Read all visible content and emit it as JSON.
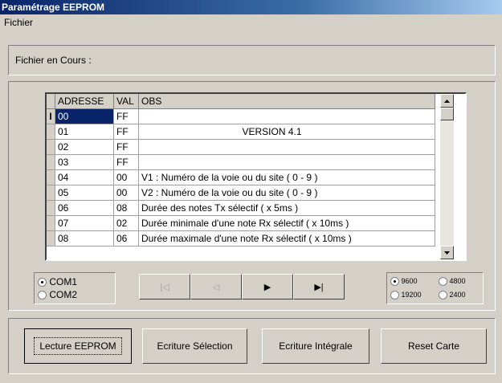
{
  "window": {
    "title": "Paramétrage EEPROM"
  },
  "menu": {
    "items": [
      "Fichier"
    ]
  },
  "file": {
    "label": "Fichier en Cours :"
  },
  "grid": {
    "columns": [
      "ADRESSE",
      "VAL",
      "OBS"
    ],
    "rows": [
      {
        "adresse": "00",
        "val": "FF",
        "obs": ""
      },
      {
        "adresse": "01",
        "val": "FF",
        "obs": "VERSION  4.1"
      },
      {
        "adresse": "02",
        "val": "FF",
        "obs": ""
      },
      {
        "adresse": "03",
        "val": "FF",
        "obs": ""
      },
      {
        "adresse": "04",
        "val": "00",
        "obs": "V1 : Numéro de la voie ou du site ( 0 - 9 )"
      },
      {
        "adresse": "05",
        "val": "00",
        "obs": "V2 : Numéro de la voie ou du site ( 0 - 9 )"
      },
      {
        "adresse": "06",
        "val": "08",
        "obs": "Durée des notes Tx sélectif ( x  5ms )"
      },
      {
        "adresse": "07",
        "val": "02",
        "obs": "Durée minimale d'une note Rx sélectif ( x  10ms )"
      },
      {
        "adresse": "08",
        "val": "06",
        "obs": "Durée maximale d'une note Rx sélectif ( x  10ms )"
      }
    ],
    "selected_row_indicator": "I"
  },
  "com_ports": {
    "options": [
      "COM1",
      "COM2"
    ],
    "selected": "COM1"
  },
  "nav": {
    "first": "|◁",
    "prev": "◁",
    "next": "▶",
    "last": "▶|"
  },
  "baud": {
    "options": [
      "9600",
      "4800",
      "19200",
      "2400"
    ],
    "selected": "9600"
  },
  "actions": {
    "read": "Lecture EEPROM",
    "write_selection": "Ecriture Sélection",
    "write_full": "Ecriture Intégrale",
    "reset": "Reset Carte"
  }
}
